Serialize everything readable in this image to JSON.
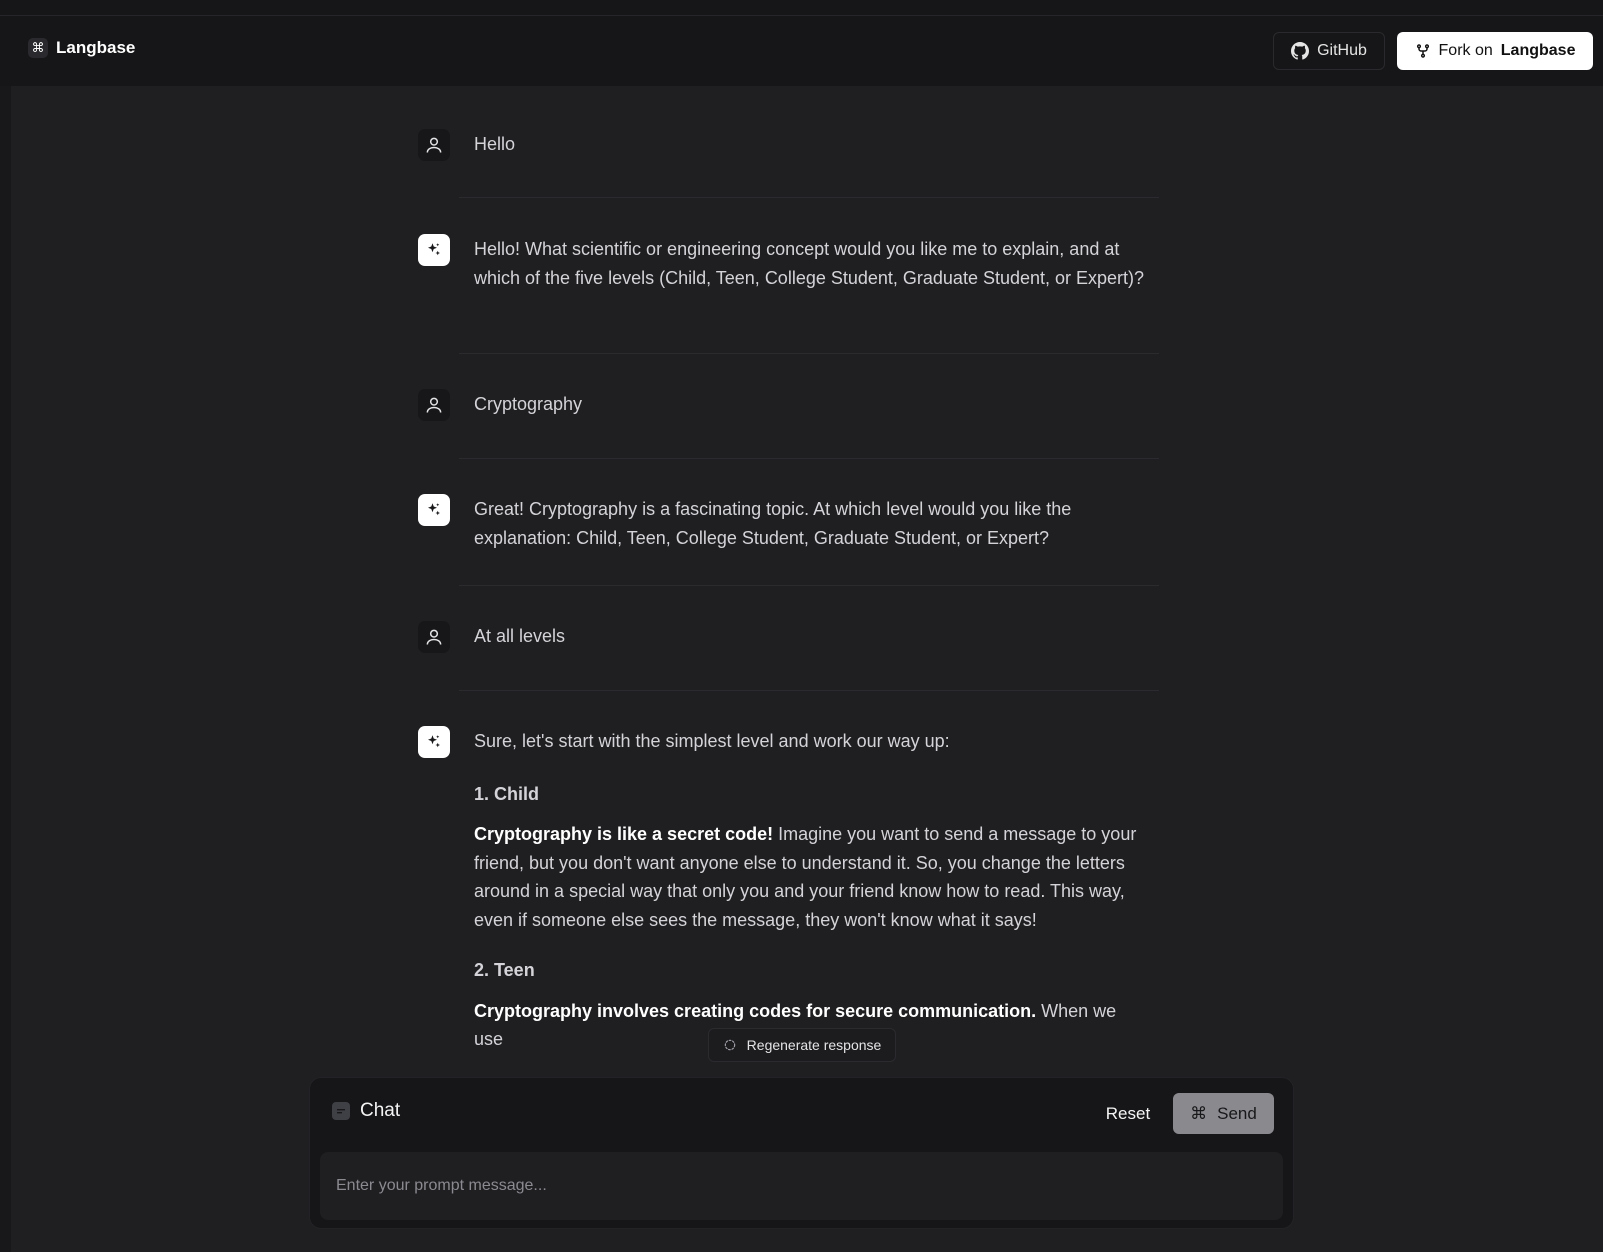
{
  "header": {
    "brand": "Langbase",
    "brand_mark": "⌘",
    "github_label": "GitHub",
    "fork_prefix": "Fork on",
    "fork_brand": "Langbase"
  },
  "messages": [
    {
      "role": "user",
      "text": "Hello"
    },
    {
      "role": "assistant",
      "text": "Hello! What scientific or engineering concept would you like me to explain, and at which of the five levels (Child, Teen, College Student, Graduate Student, or Expert)?"
    },
    {
      "role": "user",
      "text": "Cryptography"
    },
    {
      "role": "assistant",
      "text": "Great! Cryptography is a fascinating topic. At which level would you like the explanation: Child, Teen, College Student, Graduate Student, or Expert?"
    },
    {
      "role": "user",
      "text": "At all levels"
    },
    {
      "role": "assistant",
      "intro": "Sure, let's start with the simplest level and work our way up:",
      "sections": [
        {
          "heading": "1. Child",
          "lead": "Cryptography is like a secret code!",
          "body": " Imagine you want to send a message to your friend, but you don't want anyone else to understand it. So, you change the letters around in a special way that only you and your friend know how to read. This way, even if someone else sees the message, they won't know what it says!"
        },
        {
          "heading": "2. Teen",
          "lead": "Cryptography involves creating codes for secure communication.",
          "body": " When we use"
        }
      ]
    }
  ],
  "regenerate_label": "Regenerate response",
  "composer": {
    "title": "Chat",
    "reset_label": "Reset",
    "send_label": "Send",
    "send_icon": "⌘",
    "placeholder": "Enter your prompt message..."
  },
  "icons": {
    "user_avatar": "user-icon",
    "assistant_avatar": "sparkles-icon",
    "github": "github-icon",
    "fork": "git-fork-icon",
    "regenerate": "refresh-icon",
    "chat": "chat-icon"
  }
}
